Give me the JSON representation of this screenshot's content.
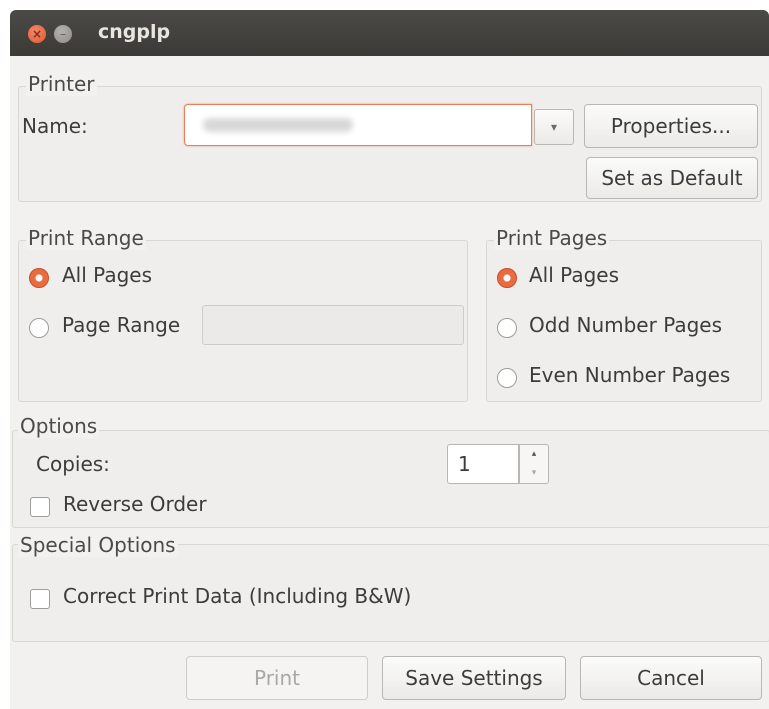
{
  "window": {
    "title": "cngplp",
    "close_glyph": "×",
    "minimize_glyph": "–"
  },
  "printer": {
    "legend": "Printer",
    "name_label": "Name:",
    "properties_label": "Properties...",
    "set_default_label": "Set as Default",
    "dropdown_icon": "▾"
  },
  "print_range": {
    "legend": "Print Range",
    "options": [
      "All Pages",
      "Page Range"
    ],
    "selected": "All Pages"
  },
  "print_pages": {
    "legend": "Print Pages",
    "options": [
      "All Pages",
      "Odd Number Pages",
      "Even Number Pages"
    ],
    "selected": "All Pages"
  },
  "options": {
    "legend": "Options",
    "copies_label": "Copies:",
    "copies_value": "1",
    "reverse_order_label": "Reverse Order",
    "reverse_order_checked": false,
    "spin_up": "▴",
    "spin_down": "▾"
  },
  "special_options": {
    "legend": "Special Options",
    "correct_print_data_label": "Correct Print Data (Including B&W)",
    "correct_print_data_checked": false
  },
  "buttons": {
    "print": "Print",
    "save_settings": "Save Settings",
    "cancel": "Cancel"
  },
  "colors": {
    "accent": "#e96b3f",
    "titlebar": "#3e3d3a",
    "dialog_bg": "#f2f1f0"
  }
}
